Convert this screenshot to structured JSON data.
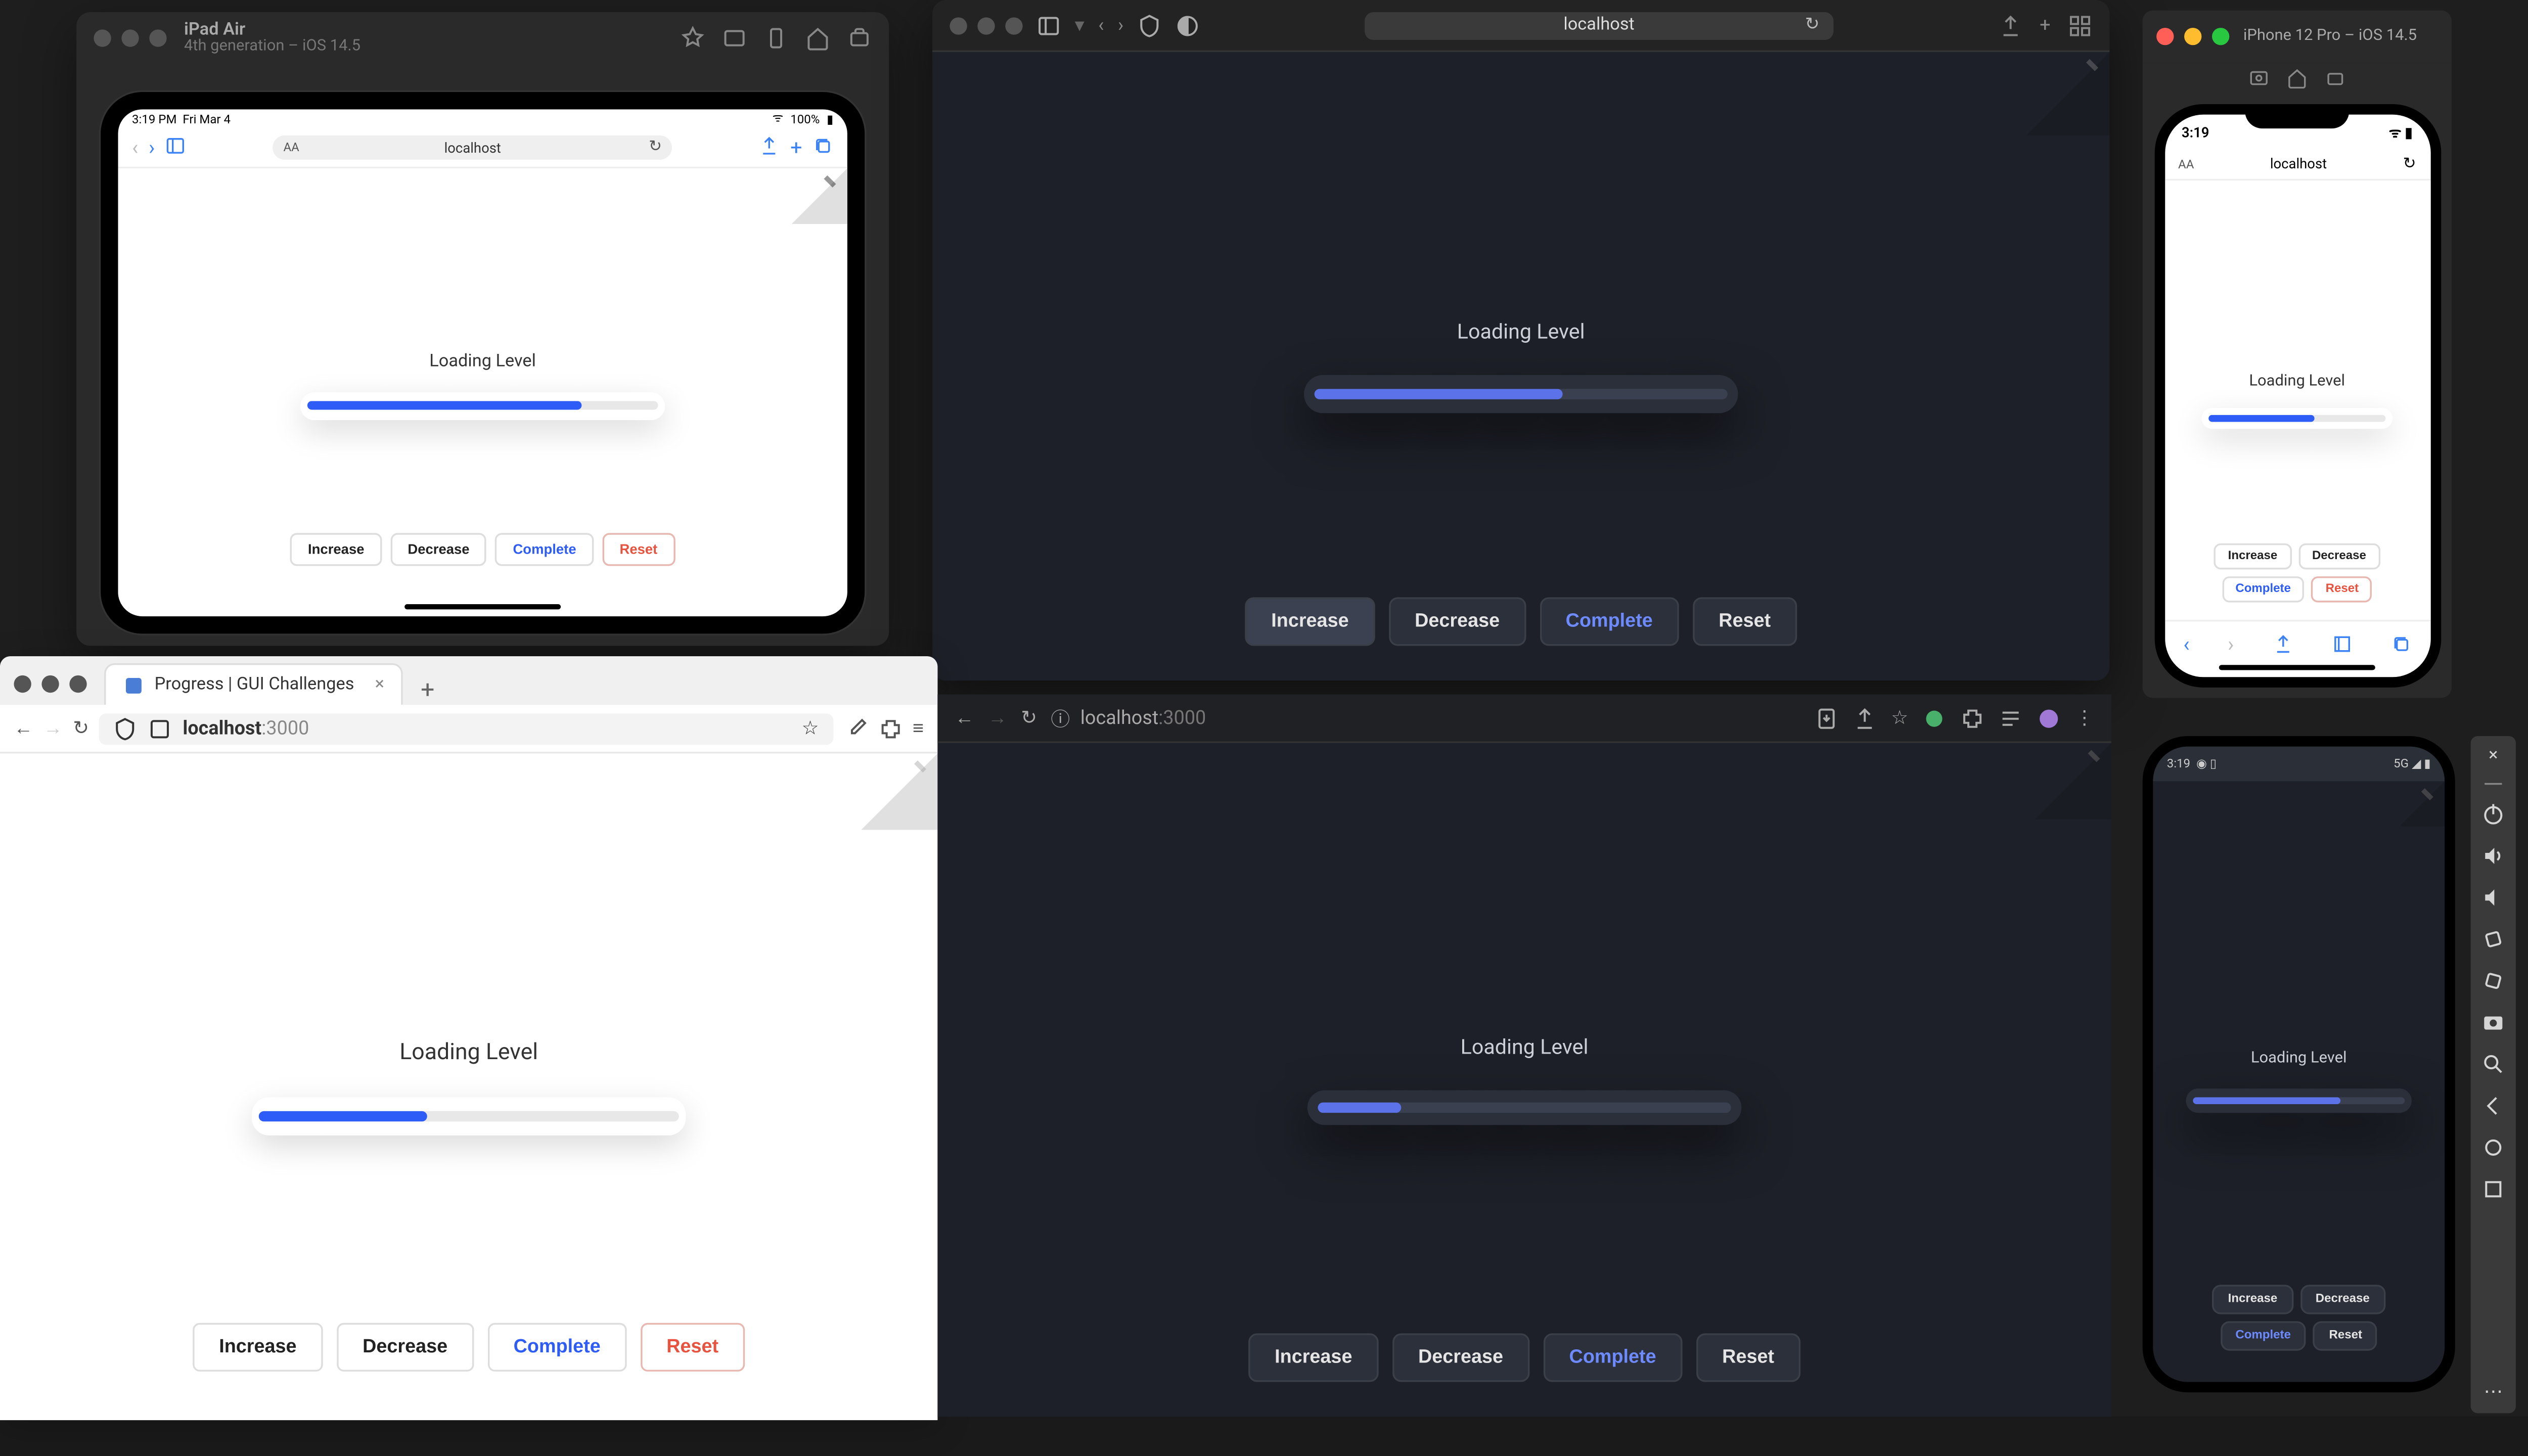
{
  "sim_ipad": {
    "device_name": "iPad Air",
    "device_detail": "4th generation – iOS 14.5",
    "status_time": "3:19 PM",
    "status_date": "Fri Mar 4",
    "status_right": "100%",
    "url_host": "localhost"
  },
  "sim_iphone": {
    "title": "iPhone 12 Pro – iOS 14.5",
    "status_time": "3:19",
    "url_host": "localhost"
  },
  "safari_main": {
    "url_host": "localhost"
  },
  "firefox": {
    "tab_title": "Progress | GUI Challenges",
    "url_host": "localhost",
    "url_port": ":3000"
  },
  "chrome": {
    "url_host": "localhost",
    "url_port": ":3000"
  },
  "android": {
    "status_time": "3:19",
    "status_right": "5G"
  },
  "demo": {
    "title": "Loading Level",
    "buttons": {
      "increase": "Increase",
      "decrease": "Decrease",
      "complete": "Complete",
      "reset": "Reset"
    }
  },
  "progress": {
    "ipad": 78,
    "iphone": 60,
    "safari_main": 60,
    "firefox": 40,
    "chrome": 20,
    "android": 70
  },
  "colors": {
    "accent_light": "#2d5df6",
    "accent_dark": "#5b72e8",
    "danger": "#e85340",
    "dark_bg": "#1d2028",
    "dark_surface": "#2a2f3a"
  }
}
